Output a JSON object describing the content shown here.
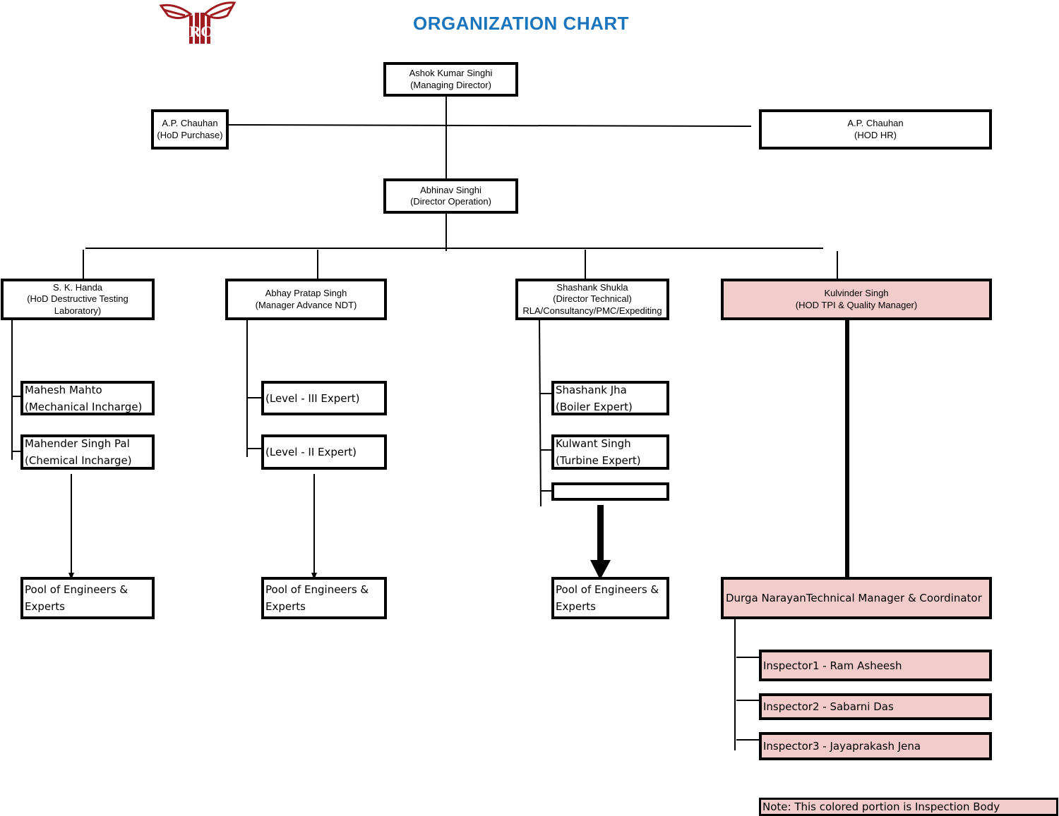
{
  "title": "ORGANIZATION CHART",
  "logo": {
    "icon": "winged-irc-logo-icon",
    "text": "IRC",
    "color": "#a01c20"
  },
  "colors": {
    "title": "#1a75bc",
    "inspection_body_fill": "#f2cbcb",
    "border": "#000000"
  },
  "top": {
    "md": {
      "name": "Ashok Kumar Singhi",
      "role": "(Managing Director)"
    },
    "purchase": {
      "name": "A.P. Chauhan",
      "role": "(HoD Purchase)"
    },
    "hr": {
      "name": "A.P. Chauhan",
      "role": "(HOD HR)"
    },
    "director_operation": {
      "name": "Abhinav Singhi",
      "role": "(Director Operation)"
    }
  },
  "departments": [
    {
      "head": {
        "name": "S. K. Handa",
        "role": "(HoD Destructive Testing",
        "role2": "Laboratory)"
      },
      "members": [
        {
          "line1": "Mahesh Mahto",
          "line2": "(Mechanical Incharge)"
        },
        {
          "line1": "Mahender Singh Pal",
          "line2": "(Chemical Incharge)"
        }
      ],
      "pool": {
        "line1": "Pool of Engineers &",
        "line2": "Experts"
      }
    },
    {
      "head": {
        "name": "Abhay Pratap Singh",
        "role": "(Manager Advance NDT)"
      },
      "members": [
        {
          "line1": "(Level - III Expert)"
        },
        {
          "line1": "(Level - II Expert)"
        }
      ],
      "pool": {
        "line1": "Pool of Engineers &",
        "line2": "Experts"
      }
    },
    {
      "head": {
        "name": "Shashank Shukla",
        "role": "(Director Technical)",
        "role2": "RLA/Consultancy/PMC/Expediting"
      },
      "members": [
        {
          "line1": "Shashank Jha",
          "line2": "(Boiler Expert)"
        },
        {
          "line1": "Kulwant Singh",
          "line2": "(Turbine Expert)"
        },
        {
          "line1": ""
        }
      ],
      "pool": {
        "line1": "Pool of Engineers &",
        "line2": "Experts"
      }
    },
    {
      "head": {
        "name": "Kulvinder Singh",
        "role": "(HOD TPI & Quality Manager)"
      },
      "coordinator": "Durga NarayanTechnical Manager & Coordinator",
      "inspectors": [
        "Inspector1 - Ram Asheesh",
        "Inspector2 - Sabarni Das",
        "Inspector3 - Jayaprakash Jena"
      ]
    }
  ],
  "note": "Note: This colored portion is Inspection Body"
}
